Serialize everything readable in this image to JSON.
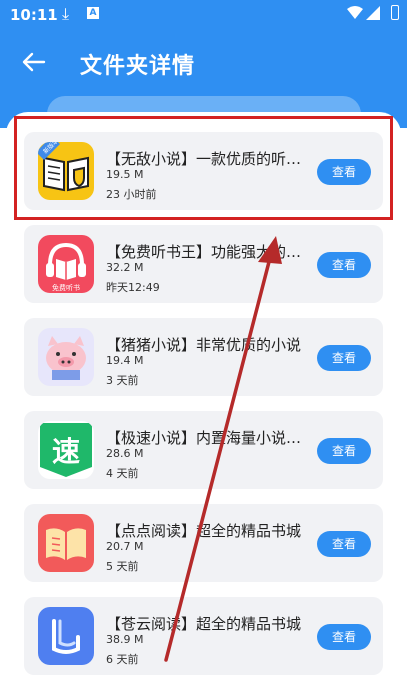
{
  "status_bar": {
    "time": "10:11",
    "download_glyph": "⤓",
    "ai_badge": "A"
  },
  "header": {
    "title": "文件夹详情"
  },
  "list": [
    {
      "name": "【无敌小说】一款优质的听书软件",
      "size": "19.5 M",
      "time": "23 小时前",
      "button": "查看",
      "icon": "book-shield-icon",
      "badge": "新版本"
    },
    {
      "name": "【免费听书王】功能强大的听书",
      "size": "32.2 M",
      "time": "昨天12:49",
      "button": "查看",
      "icon": "headphone-book-icon",
      "badge": "免费听书"
    },
    {
      "name": "【猪猪小说】非常优质的小说",
      "size": "19.4 M",
      "time": "3 天前",
      "button": "查看",
      "icon": "pig-icon"
    },
    {
      "name": "【极速小说】内置海量小说资源",
      "size": "28.6 M",
      "time": "4 天前",
      "button": "查看",
      "icon": "speed-icon",
      "badge": "速"
    },
    {
      "name": "【点点阅读】超全的精品书城",
      "size": "20.7 M",
      "time": "5 天前",
      "button": "查看",
      "icon": "open-book-icon"
    },
    {
      "name": "【苍云阅读】超全的精品书城",
      "size": "38.9 M",
      "time": "6 天前",
      "button": "查看",
      "icon": "blue-book-icon"
    }
  ],
  "colors": {
    "primary": "#2f8ff2",
    "card": "#f1f2f5",
    "annotation": "#d32222",
    "arrow": "#b52a2a"
  }
}
